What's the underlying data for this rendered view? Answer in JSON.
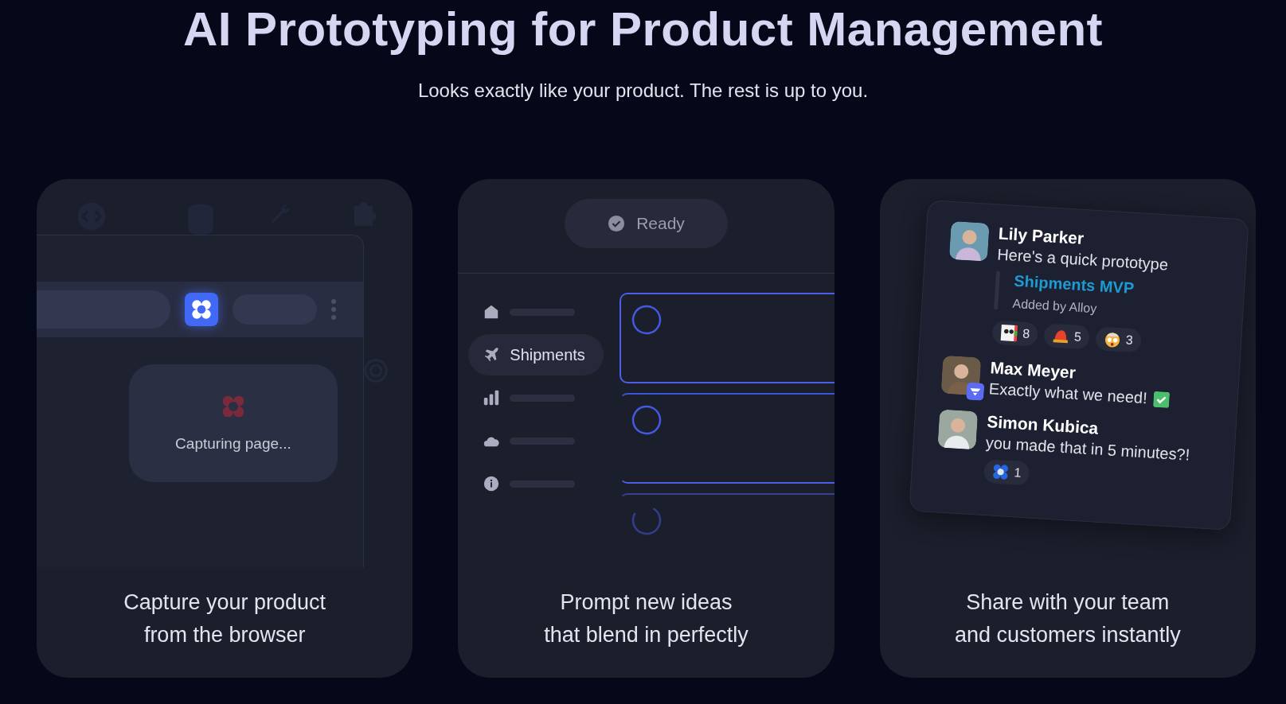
{
  "header": {
    "title": "AI Prototyping for Product Management",
    "subtitle": "Looks exactly like your product. The rest is up to you."
  },
  "cards": [
    {
      "kind": "capture",
      "status": "Capturing page...",
      "caption": "Capture your product\nfrom the browser"
    },
    {
      "kind": "prompt",
      "status": "Ready",
      "nav_items": [
        {
          "selected": false
        },
        {
          "label": "Shipments",
          "selected": true
        },
        {
          "selected": false
        },
        {
          "selected": false
        },
        {
          "selected": false
        }
      ],
      "caption": "Prompt new ideas\nthat blend in perfectly"
    },
    {
      "kind": "share",
      "messages": [
        {
          "author": "Lily Parker",
          "text": "Here's a quick prototype",
          "app_badge": false,
          "attachment": {
            "title": "Shipments MVP",
            "subtitle": "Added by Alloy"
          },
          "reactions": [
            {
              "count": "8"
            },
            {
              "count": "5"
            },
            {
              "count": "3"
            }
          ]
        },
        {
          "author": "Max Meyer",
          "text": "Exactly what we need!",
          "app_badge": true
        },
        {
          "author": "Simon Kubica",
          "text": "you made that in 5 minutes?!",
          "app_badge": false,
          "reactions": [
            {
              "count": "1"
            }
          ]
        }
      ],
      "caption": "Share with your team\nand customers instantly"
    }
  ]
}
